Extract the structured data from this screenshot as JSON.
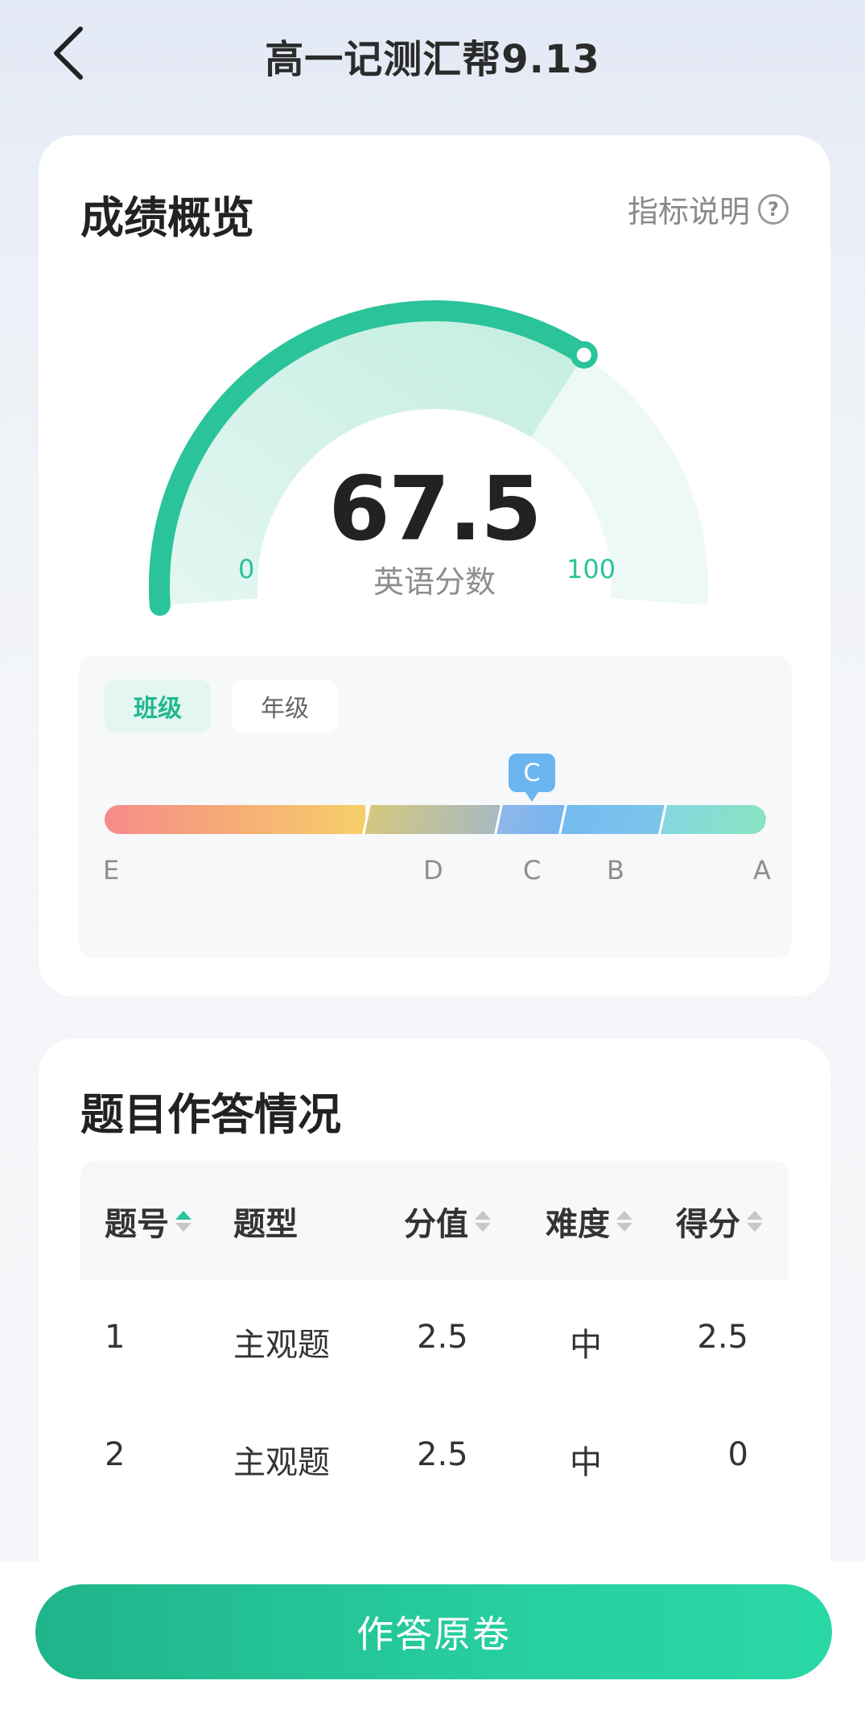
{
  "header": {
    "title": "高一记测汇帮9.13",
    "back_icon": "chevron-left-icon"
  },
  "score_card": {
    "title": "成绩概览",
    "info_link": "指标说明",
    "info_icon": "question-circle-icon",
    "score": "67.5",
    "score_fraction": 0.675,
    "subject_label": "英语分数",
    "min": "0",
    "max": "100",
    "accent_color": "#2bc39a",
    "tabs": [
      {
        "label": "班级",
        "selected": true
      },
      {
        "label": "年级",
        "selected": false
      }
    ],
    "rank_marker": "C",
    "rank_labels": [
      "E",
      "D",
      "C",
      "B",
      "A"
    ]
  },
  "answers_card": {
    "title": "题目作答情况",
    "columns": [
      "题号",
      "题型",
      "分值",
      "难度",
      "得分"
    ],
    "sort_active_column": "题号",
    "rows": [
      {
        "no": "1",
        "type": "主观题",
        "value": "2.5",
        "difficulty": "中",
        "score": "2.5"
      },
      {
        "no": "2",
        "type": "主观题",
        "value": "2.5",
        "difficulty": "中",
        "score": "0"
      }
    ]
  },
  "bottom": {
    "button_label": "作答原卷"
  }
}
